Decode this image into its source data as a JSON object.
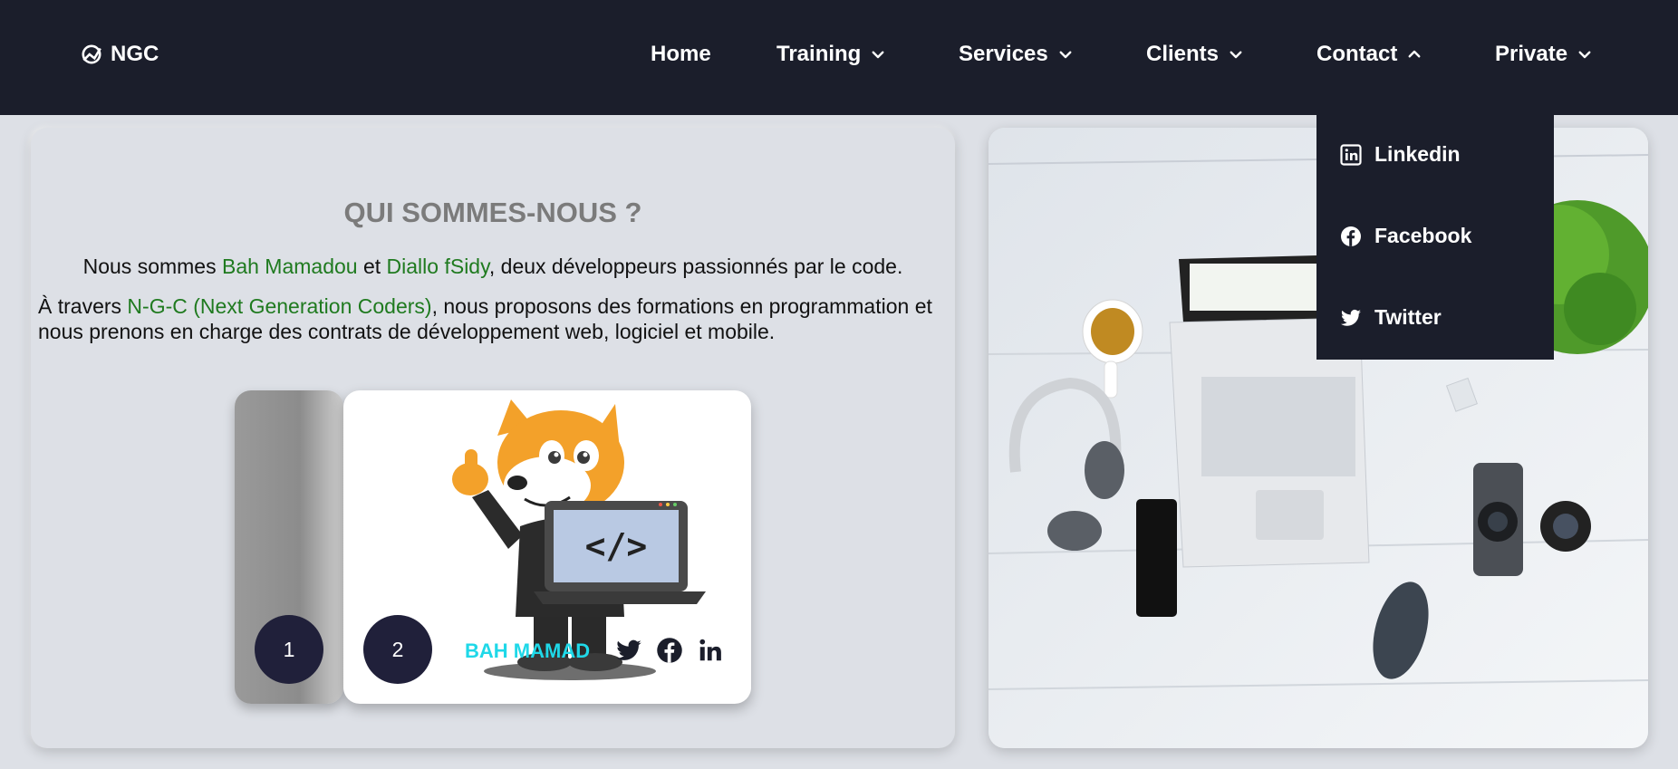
{
  "nav": {
    "logo_text": "NGC",
    "items": [
      {
        "label": "Home"
      },
      {
        "label": "Training"
      },
      {
        "label": "Services"
      },
      {
        "label": "Clients"
      },
      {
        "label": "Contact"
      },
      {
        "label": "Private"
      }
    ]
  },
  "contact_dropdown": {
    "items": [
      {
        "label": "Linkedin",
        "icon": "linkedin-icon"
      },
      {
        "label": "Facebook",
        "icon": "facebook-icon"
      },
      {
        "label": "Twitter",
        "icon": "twitter-icon"
      }
    ]
  },
  "about": {
    "title": "QUI SOMMES-NOUS ?",
    "p1_pre": "Nous sommes ",
    "p1_name1": "Bah Mamadou",
    "p1_mid": " et ",
    "p1_name2": "Diallo fSidy",
    "p1_post": ", deux développeurs passionnés par le code.",
    "p2_pre": "À travers ",
    "p2_brand": "N-G-C (Next Generation Coders)",
    "p2_post": ", nous proposons des formations en programmation et nous prenons en charge des contrats de développement web, logiciel et mobile."
  },
  "slider": {
    "dots": [
      "1",
      "2"
    ],
    "card_name": "BAH MAMAD",
    "card_icons": [
      "twitter-icon",
      "facebook-icon",
      "linkedin-icon"
    ],
    "mascot_code_text": "</>"
  },
  "colors": {
    "navbar": "#1b1e2b",
    "background": "#dde0e6",
    "name_green": "#1f7a1f",
    "card_name_cyan": "#1fd8e8",
    "dot": "#20203a"
  }
}
